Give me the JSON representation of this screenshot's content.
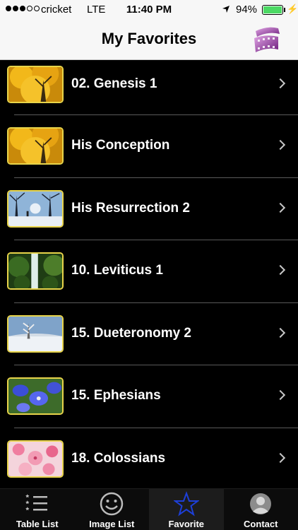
{
  "status_bar": {
    "carrier": "cricket",
    "network": "LTE",
    "time": "11:40 PM",
    "battery_percent": "94%",
    "battery_level": 0.94,
    "signal_bars_filled": 3,
    "signal_bars_total": 5
  },
  "nav": {
    "title": "My Favorites",
    "right_icon": "film-reel-icon"
  },
  "favorites": [
    {
      "label": "02. Genesis 1",
      "thumb": "yellow-tree"
    },
    {
      "label": "His Conception",
      "thumb": "yellow-tree"
    },
    {
      "label": "His Resurrection 2",
      "thumb": "winter-trees"
    },
    {
      "label": "10. Leviticus 1",
      "thumb": "waterfall"
    },
    {
      "label": "15. Dueteronomy 2",
      "thumb": "snow-field"
    },
    {
      "label": "15. Ephesians",
      "thumb": "blue-flowers"
    },
    {
      "label": "18. Colossians",
      "thumb": "pink-blossoms"
    }
  ],
  "tabs": [
    {
      "label": "Table List",
      "icon": "list-icon",
      "active": false
    },
    {
      "label": "Image List",
      "icon": "smiley-icon",
      "active": false
    },
    {
      "label": "Favorite",
      "icon": "star-icon",
      "active": true
    },
    {
      "label": "Contact",
      "icon": "contact-icon",
      "active": false
    }
  ],
  "colors": {
    "accent_star": "#1d3fd8",
    "thumb_border": "#e8d44a",
    "battery": "#4cd964"
  }
}
